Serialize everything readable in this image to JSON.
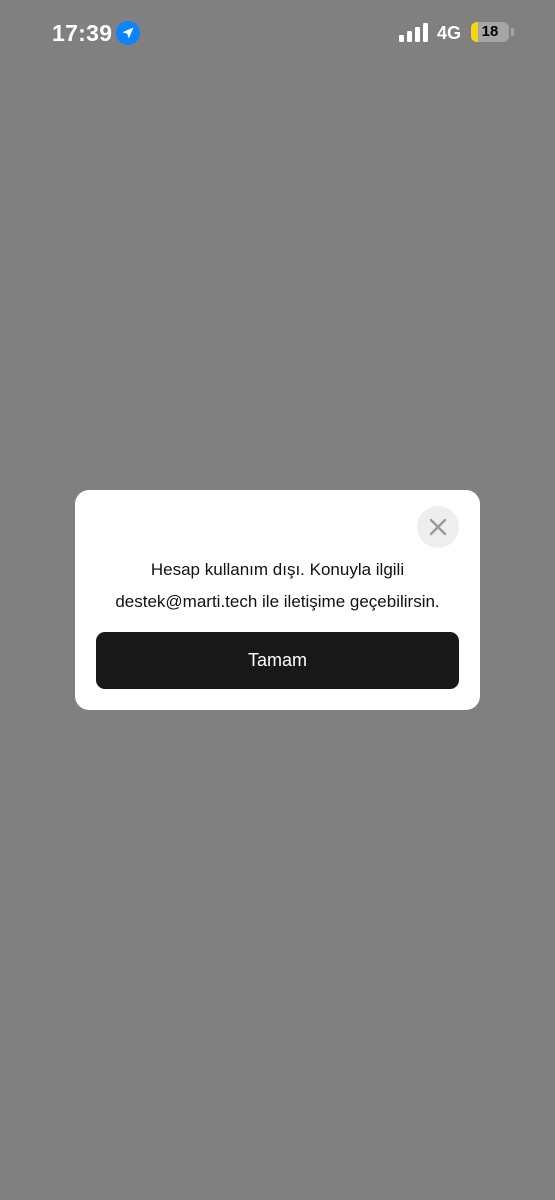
{
  "status_bar": {
    "time": "17:39",
    "location_icon": "location-arrow-icon",
    "signal_icon": "cellular-signal-icon",
    "network": "4G",
    "battery_level": "18",
    "battery_percent": 18,
    "battery_color": "#f5d60a",
    "location_color": "#0a84ff"
  },
  "dialog": {
    "close_icon": "close-icon",
    "message_line1": "Hesap kullanım dışı. Konuyla ilgili",
    "message_line2": "destek@marti.tech ile iletişime geçebilirsin.",
    "button_label": "Tamam"
  },
  "colors": {
    "backdrop": "#808080",
    "dialog_bg": "#ffffff",
    "button_bg": "#181818",
    "button_text": "#ffffff"
  }
}
